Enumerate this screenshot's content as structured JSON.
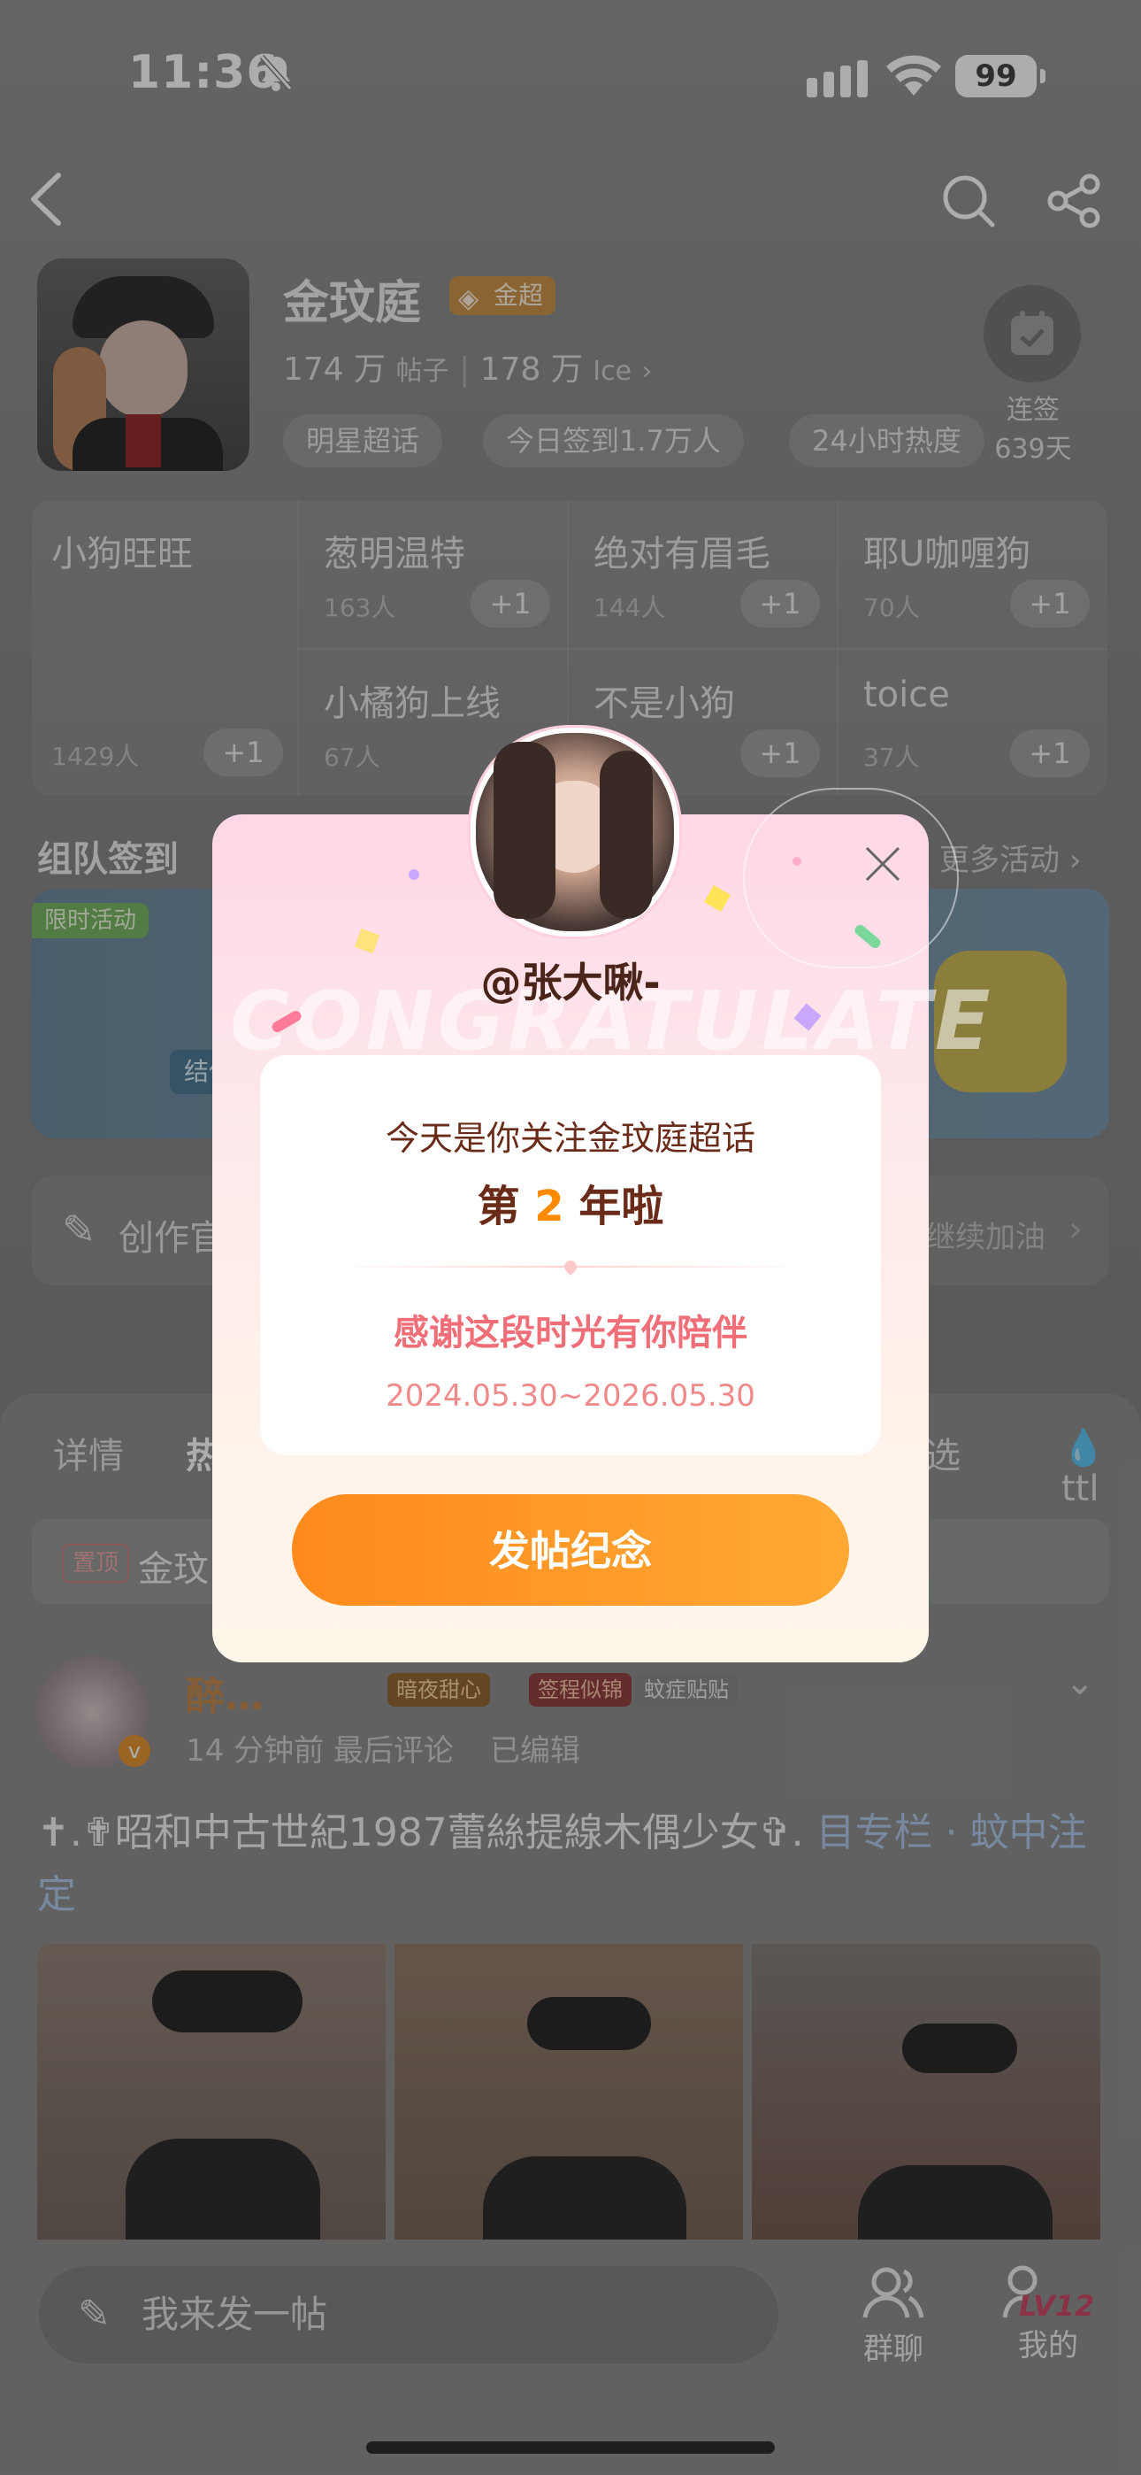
{
  "status_bar": {
    "time": "11:36",
    "battery": "99"
  },
  "header": {
    "name": "金玟庭",
    "badge": "金超",
    "posts_count": "174 万",
    "posts_label": "帖子",
    "fans_count": "178 万",
    "fans_label": "Ice",
    "chips": [
      "明星超话",
      "今日签到1.7万人",
      "24小时热度"
    ],
    "signin": {
      "label": "连签",
      "days": "639天"
    }
  },
  "fan_groups": [
    {
      "name": "小狗旺旺",
      "count": "1429人"
    },
    {
      "name": "葱明温特",
      "count": "163人"
    },
    {
      "name": "绝对有眉毛",
      "count": "144人"
    },
    {
      "name": "耶U咖喱狗",
      "count": "70人"
    },
    {
      "name": "小橘狗上线",
      "count": "67人"
    },
    {
      "name": "不是小狗",
      "count": ""
    },
    {
      "name": "toice",
      "count": "37人"
    }
  ],
  "plus_label": "+1",
  "team_section": {
    "title": "组队签到",
    "more": "更多活动"
  },
  "banner": {
    "tag": "限时活动",
    "partial_text": "结伴"
  },
  "creator_row": {
    "label": "创作官",
    "right": "继续加油"
  },
  "tabs": [
    "详情",
    "热",
    "选",
    "ttl"
  ],
  "pinned": {
    "tag": "置顶",
    "text": "金玟"
  },
  "post": {
    "author": "醉…",
    "badges": [
      "暗夜甜心",
      "签程似锦",
      "蚊症贴贴"
    ],
    "meta": "14 分钟前 最后评论",
    "edited": "已编辑",
    "text": "✝︎.✟昭和中古世紀1987蕾絲提線木偶少女✞.",
    "link": "目专栏 · 蚊中注定"
  },
  "bottom": {
    "compose": "我来发一帖",
    "chat": "群聊",
    "mine": "我的",
    "level": "LV12"
  },
  "modal": {
    "handle": "@张大啾-",
    "watermark": "CONGRATULATE",
    "line1": "今天是你关注金玟庭超话",
    "line2_prefix": "第",
    "line2_num": "2",
    "line2_suffix": "年啦",
    "thanks": "感谢这段时光有你陪伴",
    "dates": "2024.05.30~2026.05.30",
    "button": "发帖纪念",
    "accent_color": "#ff8a00"
  }
}
